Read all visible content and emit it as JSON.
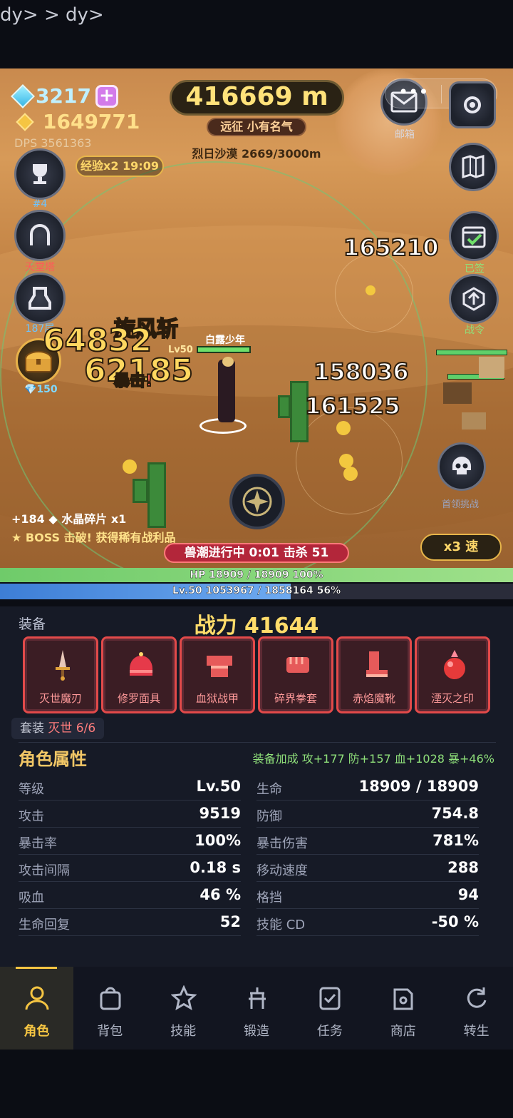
{
  "system_bar": {
    "text": "dy> > dy>"
  },
  "hud": {
    "gems": "3217",
    "gold": "1649771",
    "dps": "DPS 3561363",
    "exp_buff": "经验x2 19:09",
    "distance": "416669 m",
    "title": "远征 小有名气",
    "stage": "烈日沙漠  2669/3000m",
    "mail_label": "邮箱",
    "rank_label": "#4",
    "tower_label": "187层",
    "chest_cost": "150",
    "calendar_label": "已签",
    "gate_label": "天堂塔",
    "skull_label": "首领挑战",
    "quest_label": "战令",
    "speed_button": "x3 速",
    "wave_status": "兽潮进行中 0:01   击杀 51",
    "log": [
      "+184 ◆  水晶碎片 x1",
      "★ BOSS 击破! 获得稀有战利品"
    ],
    "damage_numbers": [
      "165210",
      "64832",
      "62185",
      "158036",
      "161525"
    ],
    "skill_name": "旋风斩",
    "crit_text": "暴击!",
    "player_name": "白露少年",
    "player_level": "Lv50"
  },
  "bars": {
    "hp_text": "HP  18909 / 18909   100%",
    "hp_fraction": 1.0,
    "lv_text": "Lv.50   1053967 / 1858164   56%",
    "lv_fraction": 0.567
  },
  "equipment": {
    "section": "装备",
    "power": "战力 41644",
    "items": [
      {
        "name": "灭世魔刃",
        "icon": "dagger-icon"
      },
      {
        "name": "修罗面具",
        "icon": "helmet-icon"
      },
      {
        "name": "血狱战甲",
        "icon": "armor-icon"
      },
      {
        "name": "碎界拳套",
        "icon": "gauntlet-icon"
      },
      {
        "name": "赤焰魔靴",
        "icon": "boot-icon"
      },
      {
        "name": "湮灭之印",
        "icon": "orb-icon"
      }
    ],
    "set_label": "套装",
    "set_value": "灭世 6/6"
  },
  "attributes": {
    "title": "角色属性",
    "bonus": "装备加成 攻+177 防+157 血+1028 暴+46%",
    "rows": [
      {
        "k": "等级",
        "v": "Lv.50"
      },
      {
        "k": "生命",
        "v": "18909 / 18909"
      },
      {
        "k": "攻击",
        "v": "9519"
      },
      {
        "k": "防御",
        "v": "754.8"
      },
      {
        "k": "暴击率",
        "v": "100%"
      },
      {
        "k": "暴击伤害",
        "v": "781%"
      },
      {
        "k": "攻击间隔",
        "v": "0.18 s"
      },
      {
        "k": "移动速度",
        "v": "288"
      },
      {
        "k": "吸血",
        "v": "46 %"
      },
      {
        "k": "格挡",
        "v": "94"
      },
      {
        "k": "生命回复",
        "v": "52"
      },
      {
        "k": "技能 CD",
        "v": "-50 %"
      }
    ]
  },
  "nav": [
    {
      "label": "角色",
      "icon": "person-icon",
      "active": true
    },
    {
      "label": "背包",
      "icon": "bag-icon"
    },
    {
      "label": "技能",
      "icon": "star-icon"
    },
    {
      "label": "锻造",
      "icon": "anvil-icon"
    },
    {
      "label": "任务",
      "icon": "checklist-icon"
    },
    {
      "label": "商店",
      "icon": "shop-icon"
    },
    {
      "label": "转生",
      "icon": "rebirth-icon"
    }
  ]
}
